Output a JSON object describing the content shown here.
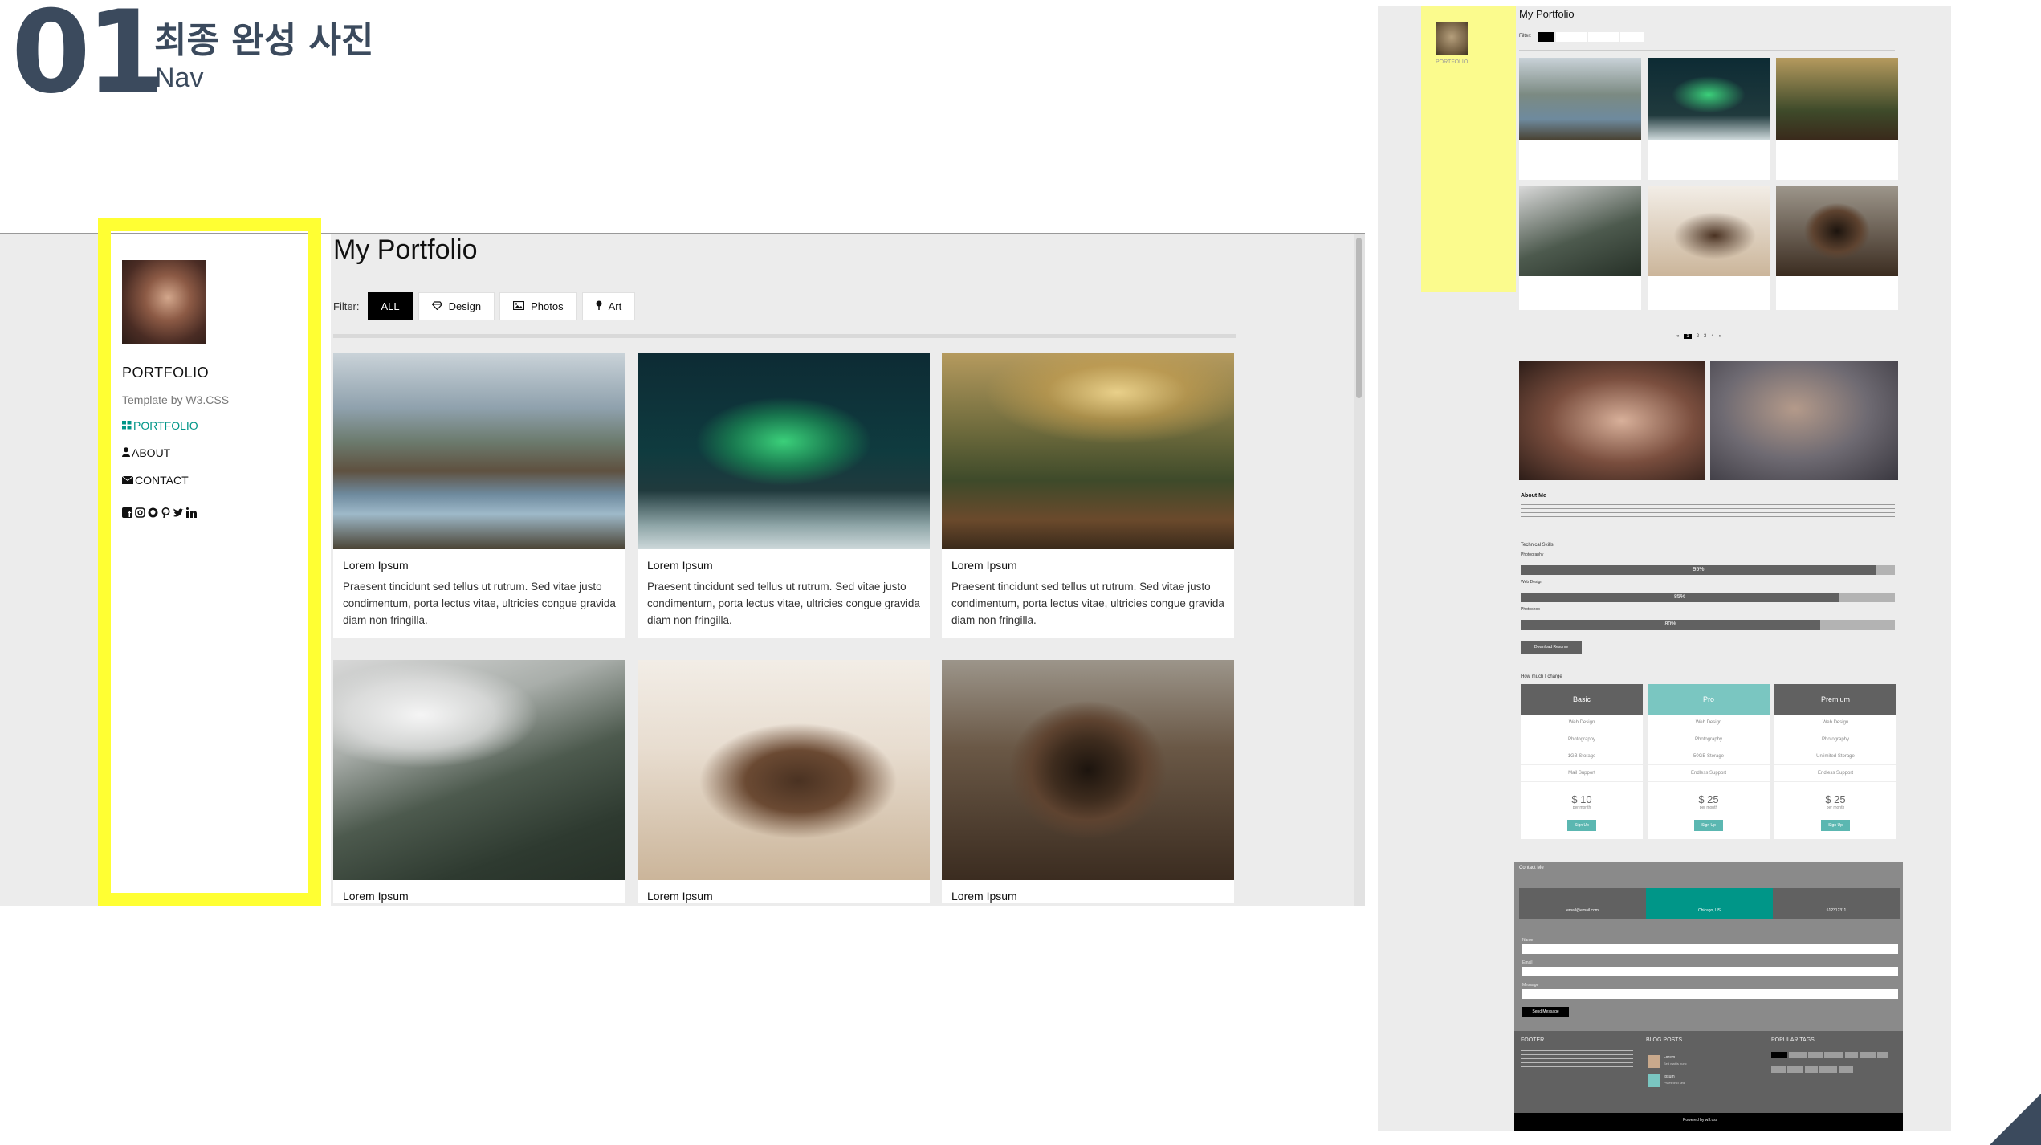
{
  "slide": {
    "number": "01",
    "title": "최종 완성 사진",
    "subtitle": "Nav"
  },
  "colors": {
    "accent": "#009688",
    "highlight": "#ffff33",
    "slide_text": "#3b4a5d",
    "button_active": "#000000"
  },
  "main": {
    "sidebar": {
      "title": "PORTFOLIO",
      "template_text": "Template by W3.CSS",
      "nav": [
        {
          "label": "PORTFOLIO",
          "icon": "th-large-icon",
          "active": true
        },
        {
          "label": "ABOUT",
          "icon": "user-icon",
          "active": false
        },
        {
          "label": "CONTACT",
          "icon": "envelope-icon",
          "active": false
        }
      ],
      "social_icons": [
        "facebook-icon",
        "instagram-icon",
        "snapchat-icon",
        "pinterest-icon",
        "twitter-icon",
        "linkedin-icon"
      ]
    },
    "page_title": "My Portfolio",
    "filter": {
      "label": "Filter:",
      "buttons": [
        {
          "label": "ALL",
          "icon": "",
          "active": true
        },
        {
          "label": "Design",
          "icon": "diamond-icon",
          "active": false
        },
        {
          "label": "Photos",
          "icon": "photo-icon",
          "active": false
        },
        {
          "label": "Art",
          "icon": "map-pin-icon",
          "active": false
        }
      ]
    },
    "cards": [
      {
        "caption": "Lorem Ipsum",
        "text": "Praesent tincidunt sed tellus ut rutrum. Sed vitae justo condimentum, porta lectus vitae, ultricies congue gravida diam non fringilla.",
        "image": "mountain-lake-photo"
      },
      {
        "caption": "Lorem Ipsum",
        "text": "Praesent tincidunt sed tellus ut rutrum. Sed vitae justo condimentum, porta lectus vitae, ultricies congue gravida diam non fringilla.",
        "image": "northern-lights-photo"
      },
      {
        "caption": "Lorem Ipsum",
        "text": "Praesent tincidunt sed tellus ut rutrum. Sed vitae justo condimentum, porta lectus vitae, ultricies congue gravida diam non fringilla.",
        "image": "mountain-sunset-photo"
      },
      {
        "caption": "Lorem Ipsum",
        "text": "",
        "image": "misty-forest-photo"
      },
      {
        "caption": "Lorem Ipsum",
        "text": "",
        "image": "coffee-beans-photo"
      },
      {
        "caption": "Lorem Ipsum",
        "text": "",
        "image": "bear-photo"
      }
    ]
  },
  "preview": {
    "title": "My Portfolio",
    "filter_label": "Filter:",
    "sidebar_title": "PORTFOLIO",
    "pagination": [
      "«",
      "1",
      "2",
      "3",
      "4",
      "»"
    ],
    "about_title": "About Me",
    "skills_title": "Technical Skills",
    "skills": [
      {
        "name": "Photography",
        "value": 95
      },
      {
        "name": "Web Design",
        "value": 85
      },
      {
        "name": "Photoshop",
        "value": 80
      }
    ],
    "download_label": "Download Resume",
    "pricing_title": "How much I charge",
    "plans": [
      {
        "name": "Basic",
        "features": [
          "Web Design",
          "Photography",
          "1GB Storage",
          "Mail Support"
        ],
        "price": "$ 10",
        "per": "per month",
        "button": "Sign Up"
      },
      {
        "name": "Pro",
        "features": [
          "Web Design",
          "Photography",
          "50GB Storage",
          "Endless Support"
        ],
        "price": "$ 25",
        "per": "per month",
        "button": "Sign Up"
      },
      {
        "name": "Premium",
        "features": [
          "Web Design",
          "Photography",
          "Unlimited Storage",
          "Endless Support"
        ],
        "price": "$ 25",
        "per": "per month",
        "button": "Sign Up"
      }
    ],
    "contact_title": "Contact Me",
    "contact_items": [
      "email@email.com",
      "Chicago, US",
      "512312311"
    ],
    "form_labels": [
      "Name",
      "Email",
      "Message"
    ],
    "send_label": "Send Message",
    "footer": {
      "col1_title": "FOOTER",
      "col2_title": "BLOG POSTS",
      "col3_title": "POPULAR TAGS",
      "posts": [
        {
          "title": "Lorem",
          "sub": "Sed mattis nunc"
        },
        {
          "title": "Ipsum",
          "sub": "Praes tinci sed"
        }
      ],
      "powered": "Powered by w3.css"
    }
  }
}
